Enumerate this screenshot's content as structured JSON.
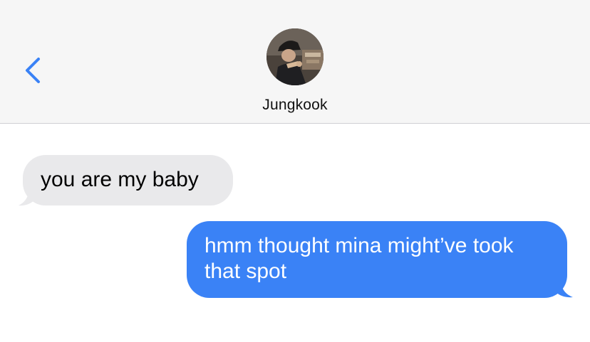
{
  "header": {
    "back_icon": "chevron-left-icon",
    "contact_name": "Jungkook",
    "accent_color": "#3a82f6"
  },
  "messages": [
    {
      "direction": "incoming",
      "text": "you are my baby",
      "bubble_color": "#e9e9eb"
    },
    {
      "direction": "outgoing",
      "text": "hmm thought mina might’ve took that spot",
      "bubble_color": "#3a82f6"
    }
  ]
}
